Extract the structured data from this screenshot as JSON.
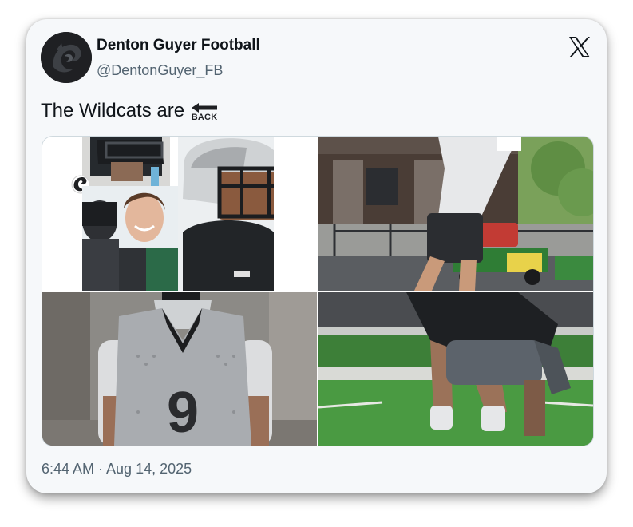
{
  "tweet": {
    "display_name": "Denton Guyer Football",
    "handle": "@DentonGuyer_FB",
    "text": "The Wildcats are",
    "emoji_label": "BACK",
    "timestamp": "6:44 AM · Aug 14, 2025"
  },
  "media": {
    "photos": [
      {
        "description_icon": "photo-collage-players",
        "jersey_text": ""
      },
      {
        "description_icon": "photo-jumping-player",
        "jersey_text": ""
      },
      {
        "description_icon": "photo-player-jersey",
        "jersey_text": "9"
      },
      {
        "description_icon": "photo-crouching-players",
        "jersey_text": ""
      }
    ]
  },
  "icons": {
    "avatar": "wildcat-logo-icon",
    "platform": "x-logo-icon",
    "emoji": "back-arrow-icon"
  },
  "colors": {
    "text_primary": "#0f1419",
    "text_secondary": "#536471",
    "card_background": "#f6f8fa"
  }
}
